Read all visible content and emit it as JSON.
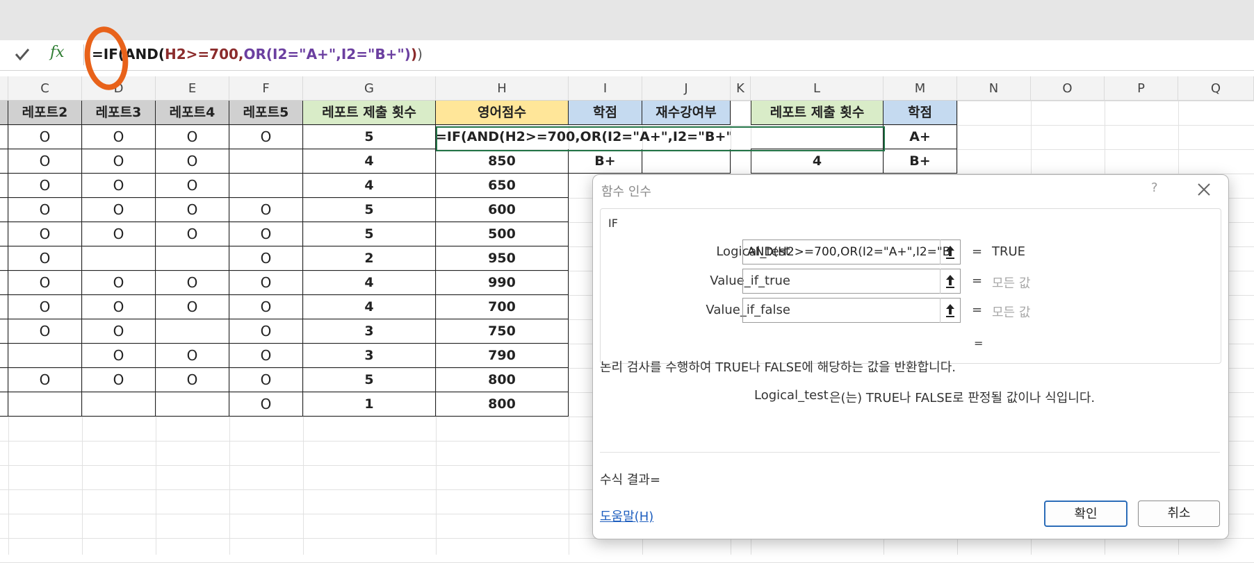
{
  "formula_bar": {
    "enter_icon": "check-icon",
    "fx_label": "fx",
    "formula_parts": [
      "=IF(",
      "AND(",
      "H2>=700,",
      "OR(",
      "I2=\"A+\",I2=\"B+\"",
      ")",
      ")",
      ")"
    ]
  },
  "columns": [
    "C",
    "D",
    "E",
    "F",
    "G",
    "H",
    "I",
    "J",
    "K",
    "L",
    "M",
    "N",
    "O",
    "P",
    "Q"
  ],
  "headers": {
    "c": "레포트2",
    "d": "레포트3",
    "e": "레포트4",
    "f": "레포트5",
    "g": "레포트 제출 횟수",
    "h": "영어점수",
    "i": "학점",
    "j": "재수강여부",
    "l": "레포트 제출 횟수",
    "m": "학점"
  },
  "rows": [
    {
      "c": "O",
      "d": "O",
      "e": "O",
      "f": "O",
      "g": "5",
      "h": "",
      "i": "",
      "j": ""
    },
    {
      "c": "O",
      "d": "O",
      "e": "O",
      "f": "",
      "g": "4",
      "h": "850",
      "i": "B+",
      "j": ""
    },
    {
      "c": "O",
      "d": "O",
      "e": "O",
      "f": "",
      "g": "4",
      "h": "650",
      "i": "",
      "j": ""
    },
    {
      "c": "O",
      "d": "O",
      "e": "O",
      "f": "O",
      "g": "5",
      "h": "600",
      "i": "",
      "j": ""
    },
    {
      "c": "O",
      "d": "O",
      "e": "O",
      "f": "O",
      "g": "5",
      "h": "500",
      "i": "",
      "j": ""
    },
    {
      "c": "O",
      "d": "",
      "e": "",
      "f": "O",
      "g": "2",
      "h": "950",
      "i": "",
      "j": ""
    },
    {
      "c": "O",
      "d": "O",
      "e": "O",
      "f": "O",
      "g": "4",
      "h": "990",
      "i": "",
      "j": ""
    },
    {
      "c": "O",
      "d": "O",
      "e": "O",
      "f": "O",
      "g": "4",
      "h": "700",
      "i": "",
      "j": ""
    },
    {
      "c": "O",
      "d": "O",
      "e": "",
      "f": "O",
      "g": "3",
      "h": "750",
      "i": "",
      "j": ""
    },
    {
      "c": "",
      "d": "O",
      "e": "O",
      "f": "O",
      "g": "3",
      "h": "790",
      "i": "",
      "j": ""
    },
    {
      "c": "O",
      "d": "O",
      "e": "O",
      "f": "O",
      "g": "5",
      "h": "800",
      "i": "",
      "j": ""
    },
    {
      "c": "",
      "d": "",
      "e": "",
      "f": "O",
      "g": "1",
      "h": "800",
      "i": "",
      "j": ""
    }
  ],
  "editing_cell_text": "=IF(AND(H2>=700,OR(I2=\"A+\",I2=\"B+\")))",
  "side_table": [
    {
      "l": "",
      "m": "A+"
    },
    {
      "l": "4",
      "m": "B+"
    }
  ],
  "dialog": {
    "title": "함수 인수",
    "help_glyph": "?",
    "group_label": "IF",
    "args": [
      {
        "name": "Logical_test",
        "value": "AND(H2>=700,OR(I2=\"A+\",I2=\"B",
        "eq": "=",
        "result": "TRUE"
      },
      {
        "name": "Value_if_true",
        "value": "",
        "eq": "=",
        "result": "모든 값"
      },
      {
        "name": "Value_if_false",
        "value": "",
        "eq": "=",
        "result": "모든 값"
      }
    ],
    "overall_eq": "=",
    "description": "논리 검사를 수행하여 TRUE나 FALSE에 해당하는 값을 반환합니다.",
    "arg_desc_name": "Logical_test",
    "arg_desc": "은(는) TRUE나 FALSE로 판정될 값이나 식입니다.",
    "formula_result_label": "수식 결과=",
    "help_link": "도움말(H)",
    "ok": "확인",
    "cancel": "취소"
  }
}
